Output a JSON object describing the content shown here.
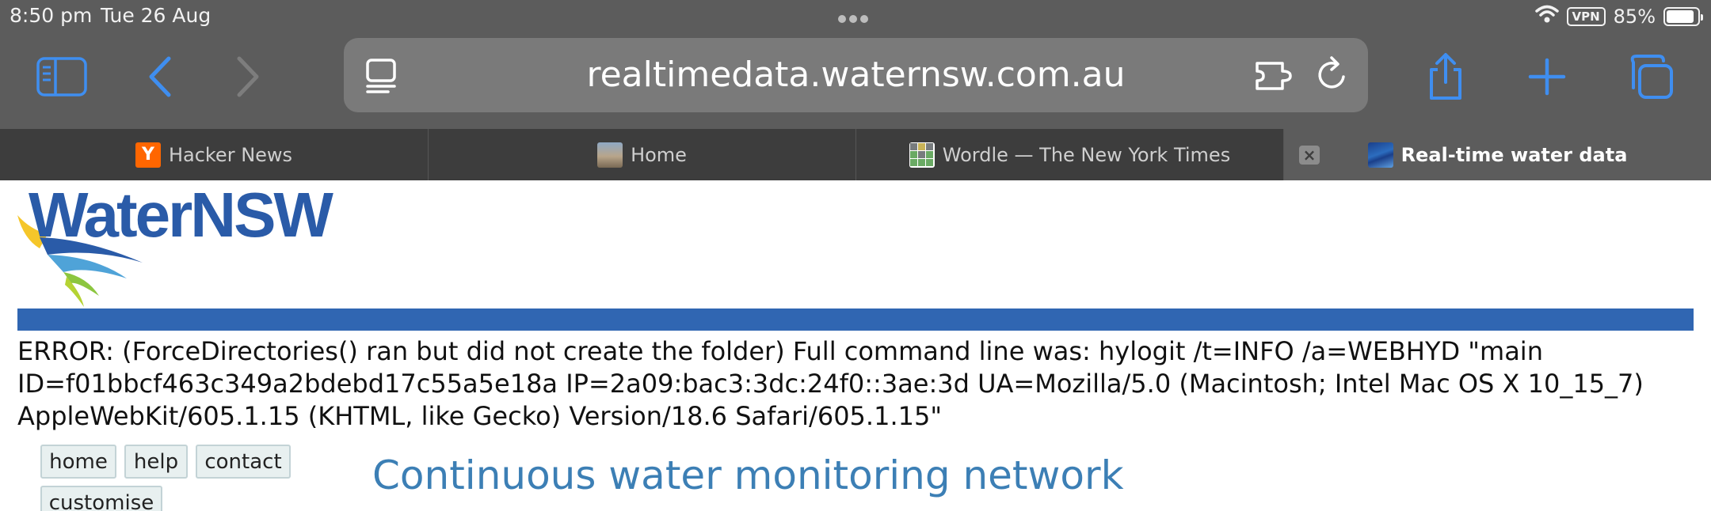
{
  "status_bar": {
    "time": "8:50 pm",
    "date": "Tue 26 Aug",
    "vpn_label": "VPN",
    "battery": "85%"
  },
  "toolbar": {
    "url": "realtimedata.waternsw.com.au",
    "accent_color": "#3f8ef0"
  },
  "tabs": [
    {
      "label": "Hacker News",
      "favicon": "Y",
      "active": false
    },
    {
      "label": "Home",
      "active": false
    },
    {
      "label": "Wordle — The New York Times",
      "active": false
    },
    {
      "label": "Real-time water data",
      "active": true
    }
  ],
  "page": {
    "logo_text": "WaterNSW",
    "brand_color": "#3066b2",
    "error_message": "ERROR: (ForceDirectories() ran but did not create the folder) Full command line was: hylogit /t=INFO /a=WEBHYD \"main ID=f01bbcf463c349a2bdebd17c55a5e18a IP=2a09:bac3:3dc:24f0::3ae:3d UA=Mozilla/5.0 (Macintosh; Intel Mac OS X 10_15_7) AppleWebKit/605.1.15 (KHTML, like Gecko) Version/18.6 Safari/605.1.15\"",
    "nav": {
      "home": "home",
      "help": "help",
      "contact": "contact",
      "customise": "customise"
    },
    "heading": "Continuous water monitoring network",
    "heading_color": "#3c7fb5"
  }
}
